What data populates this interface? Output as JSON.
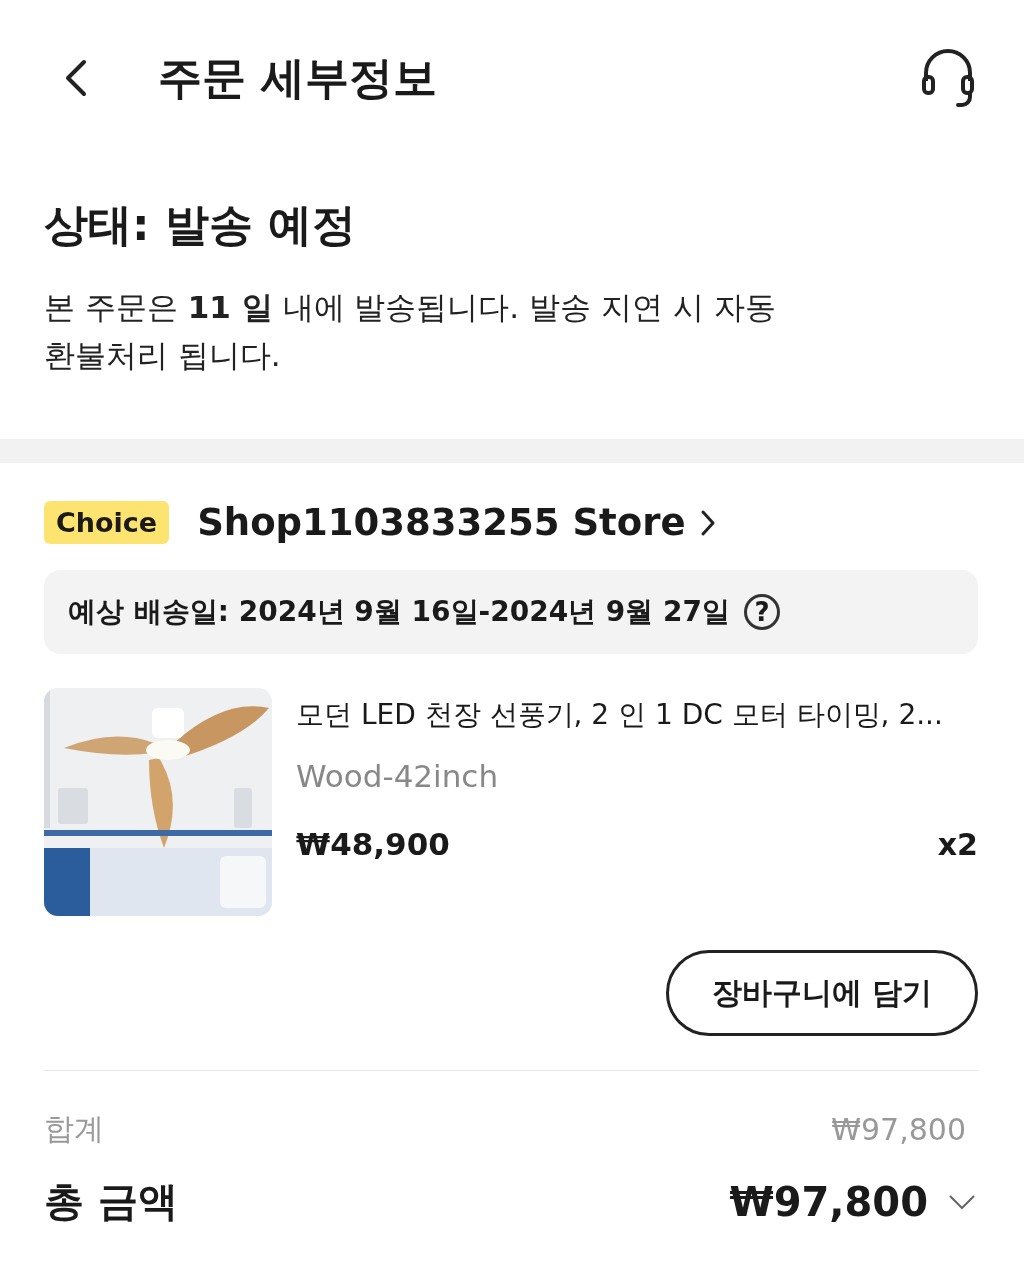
{
  "header": {
    "title": "주문 세부정보"
  },
  "status": {
    "title": "상태: 발송 예정",
    "message": "본 주문은 **11 일** 내에 발송됩니다. 발송 지연 시 자동 환불처리 됩니다."
  },
  "store": {
    "badge": "Choice",
    "name": "Shop1103833255 Store"
  },
  "delivery": {
    "text": "예상 배송일: 2024년 9월 16일-2024년 9월 27일",
    "help": "?"
  },
  "items": [
    {
      "kind": "picture",
      "title": "모던 LED 천장 선풍기, 2 인 1 DC 모터 타이밍, 2...",
      "variant": "Wood-42inch",
      "price": "₩48,900",
      "quantity": "x2",
      "button": "장바구니에 담기"
    }
  ],
  "summary": {
    "subtotal_label": "합계",
    "subtotal": "₩97,800",
    "total_label": "총 금액",
    "total": "₩97,800",
    "expanded": false
  }
}
